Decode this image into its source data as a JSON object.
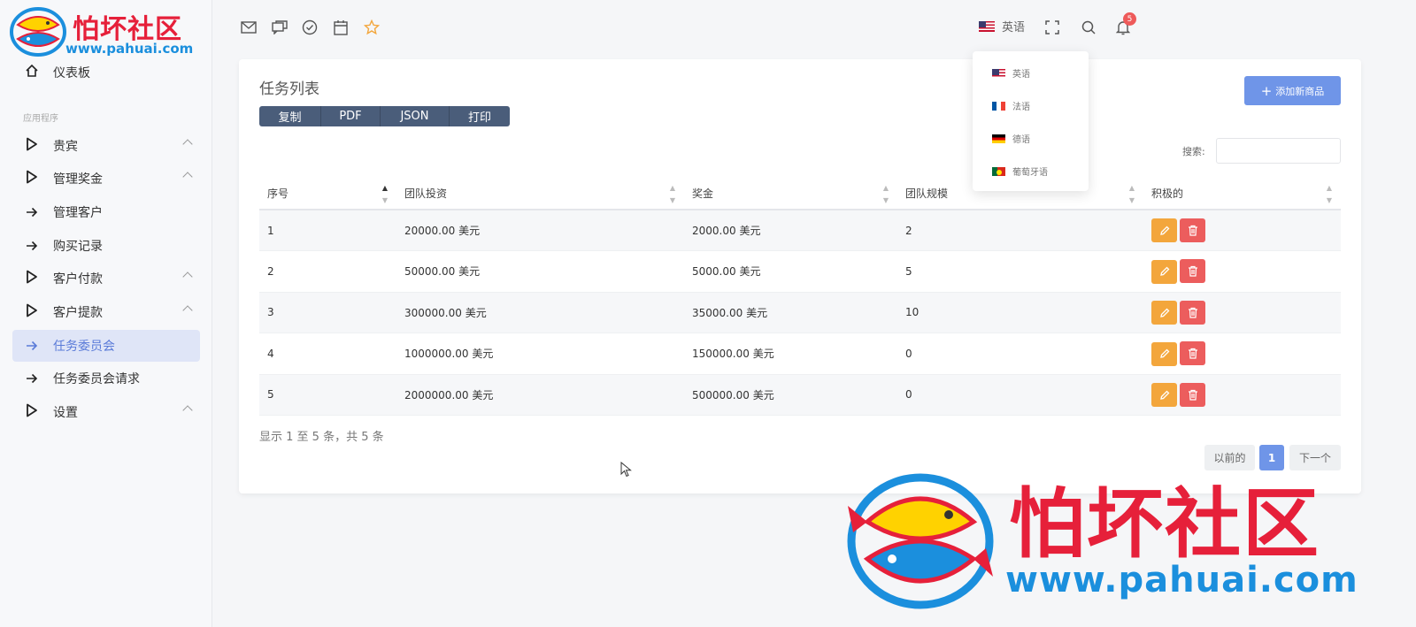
{
  "logo": {
    "brand": "怕坏社区",
    "url": "www.pahuai.com"
  },
  "sidebar": {
    "dashboard": "仪表板",
    "section": "应用程序",
    "items": [
      {
        "label": "贵宾",
        "icon": "play-icon",
        "expandable": true
      },
      {
        "label": "管理奖金",
        "icon": "play-icon",
        "expandable": true
      },
      {
        "label": "管理客户",
        "icon": "arrow-right-icon",
        "expandable": false
      },
      {
        "label": "购买记录",
        "icon": "arrow-right-icon",
        "expandable": false
      },
      {
        "label": "客户付款",
        "icon": "play-icon",
        "expandable": true
      },
      {
        "label": "客户提款",
        "icon": "play-icon",
        "expandable": true
      },
      {
        "label": "任务委员会",
        "icon": "arrow-right-icon",
        "expandable": false,
        "active": true
      },
      {
        "label": "任务委员会请求",
        "icon": "arrow-right-icon",
        "expandable": false
      },
      {
        "label": "设置",
        "icon": "play-icon",
        "expandable": true
      }
    ]
  },
  "topbar": {
    "icons": [
      "mail-icon",
      "chat-icon",
      "check-circle-icon",
      "calendar-icon",
      "star-icon"
    ],
    "language": "英语",
    "notification_count": "5"
  },
  "language_menu": [
    {
      "label": "英语",
      "flag": "us"
    },
    {
      "label": "法语",
      "flag": "fr"
    },
    {
      "label": "德语",
      "flag": "de"
    },
    {
      "label": "葡萄牙语",
      "flag": "pt"
    }
  ],
  "card": {
    "title": "任务列表",
    "export_buttons": [
      "复制",
      "PDF",
      "JSON",
      "打印"
    ],
    "add_button": "添加新商品",
    "search_label": "搜索:",
    "columns": [
      "序号",
      "团队投资",
      "奖金",
      "团队规模",
      "积极的"
    ],
    "rows": [
      [
        "1",
        "20000.00 美元",
        "2000.00 美元",
        "2"
      ],
      [
        "2",
        "50000.00 美元",
        "5000.00 美元",
        "5"
      ],
      [
        "3",
        "300000.00 美元",
        "35000.00 美元",
        "10"
      ],
      [
        "4",
        "1000000.00 美元",
        "150000.00 美元",
        "0"
      ],
      [
        "5",
        "2000000.00 美元",
        "500000.00 美元",
        "0"
      ]
    ],
    "info": "显示 1 至 5 条，共 5 条",
    "pagination": {
      "prev": "以前的",
      "current": "1",
      "next": "下一个"
    }
  },
  "watermark": {
    "brand": "怕坏社区",
    "url": "www.pahuai.com"
  },
  "colors": {
    "primary": "#6f95e8",
    "edit": "#f3a63c",
    "delete": "#ec5d5d",
    "export": "#4a5d7a",
    "brand": "#e6203a"
  }
}
